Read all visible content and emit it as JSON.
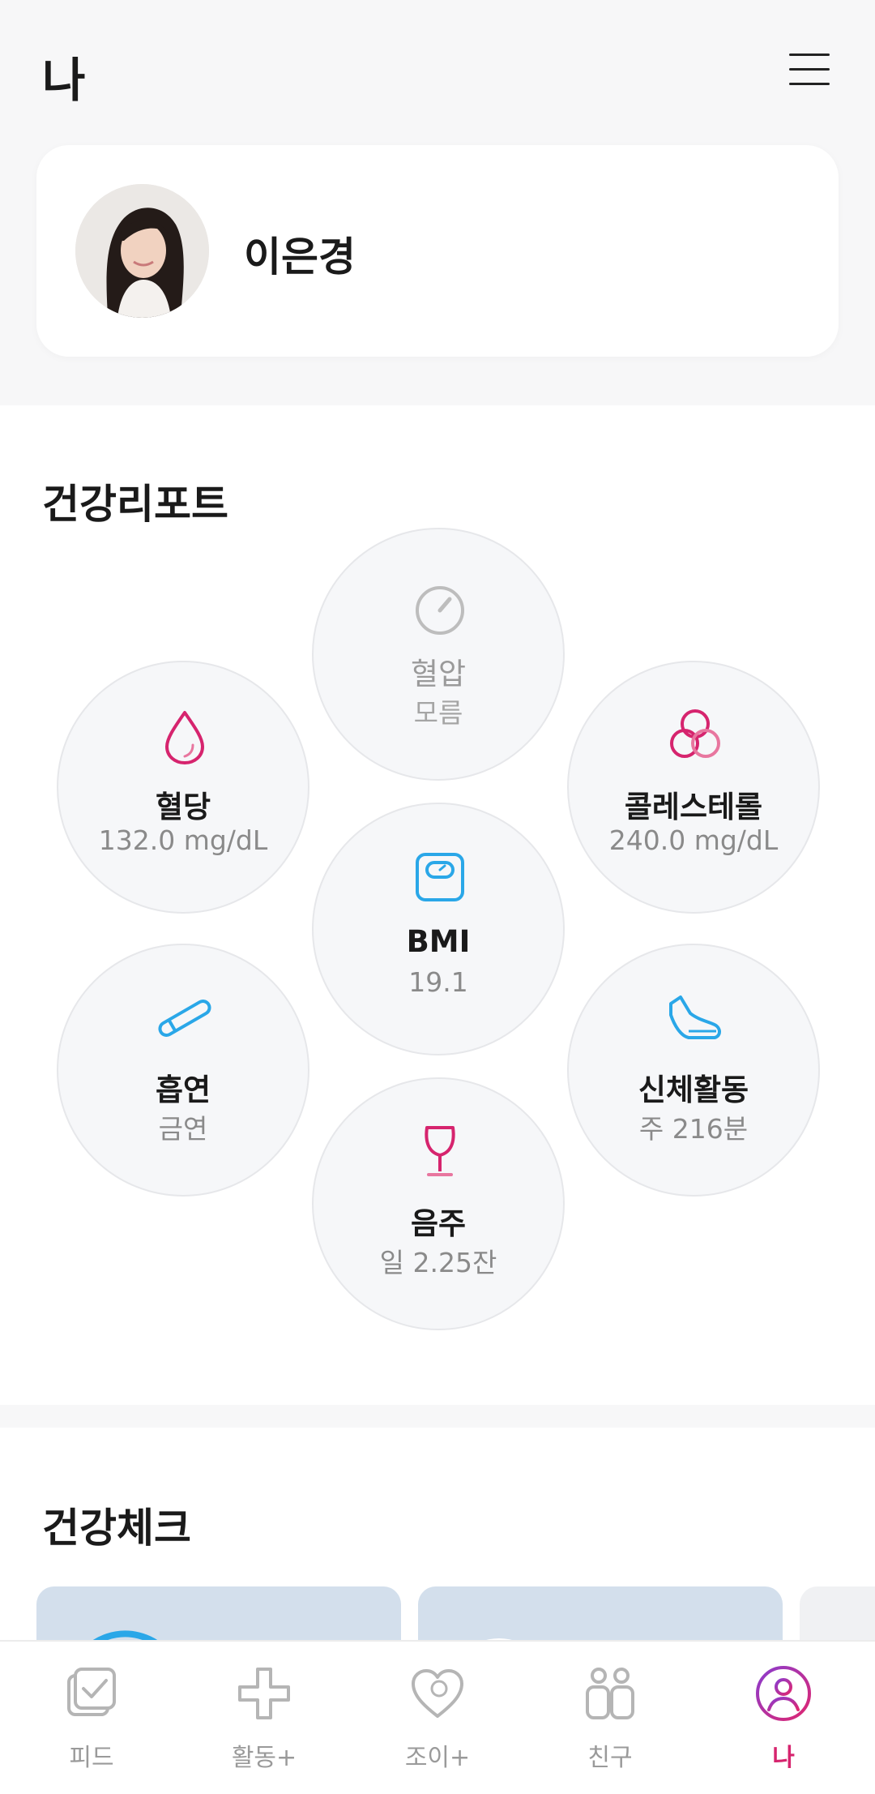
{
  "header": {
    "title": "나",
    "menu_icon": "hamburger-menu-icon"
  },
  "profile": {
    "name": "이은경",
    "avatar": "user-photo"
  },
  "health_report": {
    "title": "건강리포트",
    "items": [
      {
        "id": "blood-pressure",
        "label": "혈압",
        "value": "모름",
        "icon": "gauge-icon",
        "color": "#b8b8b8"
      },
      {
        "id": "blood-sugar",
        "label": "혈당",
        "value": "132.0 mg/dL",
        "icon": "drop-icon",
        "color": "#d6246e"
      },
      {
        "id": "cholesterol",
        "label": "콜레스테롤",
        "value": "240.0 mg/dL",
        "icon": "cells-icon",
        "color": "#d6246e"
      },
      {
        "id": "bmi",
        "label": "BMI",
        "value": "19.1",
        "icon": "scale-icon",
        "color": "#2aa7e8"
      },
      {
        "id": "smoking",
        "label": "흡연",
        "value": "금연",
        "icon": "cigarette-icon",
        "color": "#2aa7e8"
      },
      {
        "id": "activity",
        "label": "신체활동",
        "value": "주 216분",
        "icon": "sneaker-icon",
        "color": "#2aa7e8"
      },
      {
        "id": "drinking",
        "label": "음주",
        "value": "일 2.25잔",
        "icon": "wine-glass-icon",
        "color": "#d6246e"
      }
    ]
  },
  "health_check": {
    "title": "건강체크"
  },
  "bottom_nav": [
    {
      "label": "피드",
      "icon": "feed-check-icon",
      "active": false
    },
    {
      "label": "활동+",
      "icon": "activity-plus-icon",
      "active": false
    },
    {
      "label": "조이+",
      "icon": "heart-icon",
      "active": false
    },
    {
      "label": "친구",
      "icon": "friends-icon",
      "active": false
    },
    {
      "label": "나",
      "icon": "profile-icon",
      "active": true
    }
  ],
  "colors": {
    "accent_pink": "#d6246e",
    "accent_blue": "#2aa7e8",
    "inactive_gray": "#9a9a9a",
    "card_blue": "#d3dfec"
  }
}
